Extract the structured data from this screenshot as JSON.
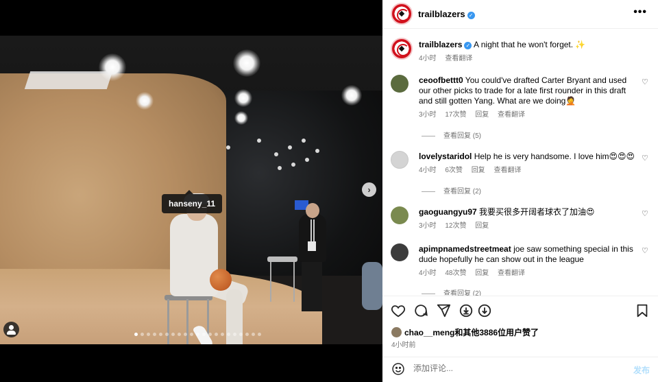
{
  "photo": {
    "tag_username": "hanseny_11",
    "next_symbol": "›",
    "page_count": 21,
    "active_page": 1
  },
  "post": {
    "author": "trailblazers",
    "more_symbol": "•••",
    "caption_text": "A night that he won't forget. ✨",
    "caption_time": "4小时",
    "translate_label": "查看翻译"
  },
  "comments": [
    {
      "username": "ceoofbettt0",
      "text": "You could've drafted Carter Bryant and used our other picks to trade for a late first rounder in this draft and still gotten Yang. What are we doing🤦",
      "time": "3小时",
      "likes": "17次赞",
      "reply": "回复",
      "translate": "查看翻译",
      "view_replies": "查看回复 (5)",
      "avatar_color": "#5b6b3e"
    },
    {
      "username": "lovelystaridol",
      "text": "Help he is very handsome. I love him😍😍😍",
      "time": "4小时",
      "likes": "6次赞",
      "reply": "回复",
      "translate": "查看翻译",
      "view_replies": "查看回复 (2)",
      "avatar_color": "#c7c7c7"
    },
    {
      "username": "gaoguangyu97",
      "text": "我要买很多开阔者球衣了加油😍",
      "time": "3小时",
      "likes": "12次赞",
      "reply": "回复",
      "translate": "",
      "view_replies": "",
      "avatar_color": "#7a8a4f"
    },
    {
      "username": "apimpnamedstreetmeat",
      "text": "joe saw something special in this dude hopefully he can show out in the league",
      "time": "4小时",
      "likes": "48次赞",
      "reply": "回复",
      "translate": "查看翻译",
      "view_replies": "查看回复 (2)",
      "avatar_color": "#3c3c3c"
    }
  ],
  "likes": {
    "text": "chao__meng和其他3886位用户赞了",
    "time_ago": "4小时前"
  },
  "comment_box": {
    "placeholder": "添加评论...",
    "post_label": "发布"
  },
  "colors": {
    "accent_blue": "#3897f0",
    "brand_red": "#d1111c",
    "muted_text": "#737373"
  }
}
